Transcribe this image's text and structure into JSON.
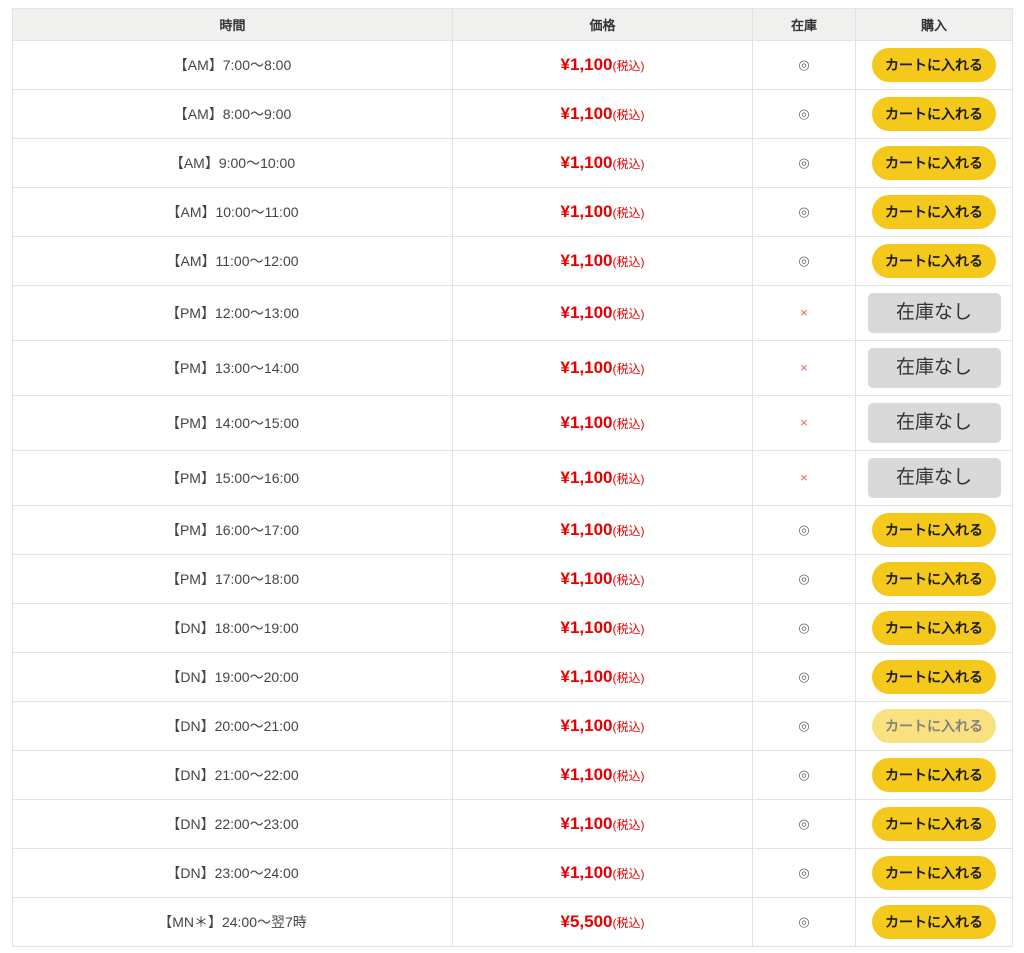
{
  "table": {
    "headers": {
      "time": "時間",
      "price": "価格",
      "stock": "在庫",
      "purchase": "購入"
    },
    "button_labels": {
      "add_to_cart": "カートに入れる",
      "out_of_stock": "在庫なし"
    },
    "stock_symbols": {
      "available": "◎",
      "unavailable": "×"
    },
    "tax_label": "(税込)",
    "rows": [
      {
        "time": "【AM】7:00〜8:00",
        "price": "¥1,100",
        "stock": "available",
        "action": "cart",
        "faded": false
      },
      {
        "time": "【AM】8:00〜9:00",
        "price": "¥1,100",
        "stock": "available",
        "action": "cart",
        "faded": false
      },
      {
        "time": "【AM】9:00〜10:00",
        "price": "¥1,100",
        "stock": "available",
        "action": "cart",
        "faded": false
      },
      {
        "time": "【AM】10:00〜11:00",
        "price": "¥1,100",
        "stock": "available",
        "action": "cart",
        "faded": false
      },
      {
        "time": "【AM】11:00〜12:00",
        "price": "¥1,100",
        "stock": "available",
        "action": "cart",
        "faded": false
      },
      {
        "time": "【PM】12:00〜13:00",
        "price": "¥1,100",
        "stock": "unavailable",
        "action": "soldout",
        "faded": false
      },
      {
        "time": "【PM】13:00〜14:00",
        "price": "¥1,100",
        "stock": "unavailable",
        "action": "soldout",
        "faded": false
      },
      {
        "time": "【PM】14:00〜15:00",
        "price": "¥1,100",
        "stock": "unavailable",
        "action": "soldout",
        "faded": false
      },
      {
        "time": "【PM】15:00〜16:00",
        "price": "¥1,100",
        "stock": "unavailable",
        "action": "soldout",
        "faded": false
      },
      {
        "time": "【PM】16:00〜17:00",
        "price": "¥1,100",
        "stock": "available",
        "action": "cart",
        "faded": false
      },
      {
        "time": "【PM】17:00〜18:00",
        "price": "¥1,100",
        "stock": "available",
        "action": "cart",
        "faded": false
      },
      {
        "time": "【DN】18:00〜19:00",
        "price": "¥1,100",
        "stock": "available",
        "action": "cart",
        "faded": false
      },
      {
        "time": "【DN】19:00〜20:00",
        "price": "¥1,100",
        "stock": "available",
        "action": "cart",
        "faded": false
      },
      {
        "time": "【DN】20:00〜21:00",
        "price": "¥1,100",
        "stock": "available",
        "action": "cart",
        "faded": true
      },
      {
        "time": "【DN】21:00〜22:00",
        "price": "¥1,100",
        "stock": "available",
        "action": "cart",
        "faded": false
      },
      {
        "time": "【DN】22:00〜23:00",
        "price": "¥1,100",
        "stock": "available",
        "action": "cart",
        "faded": false
      },
      {
        "time": "【DN】23:00〜24:00",
        "price": "¥1,100",
        "stock": "available",
        "action": "cart",
        "faded": false
      },
      {
        "time": "【MN＊】24:00〜翌7時",
        "price": "¥5,500",
        "stock": "available",
        "action": "cart",
        "faded": false
      }
    ]
  },
  "colors": {
    "button_yellow": "#f5c91c",
    "soldout_gray": "#d9d9d9",
    "price_red": "#e60000",
    "cross_red": "#ff5a55",
    "circle_gray": "#666666",
    "header_bg": "#f0f0ef"
  }
}
